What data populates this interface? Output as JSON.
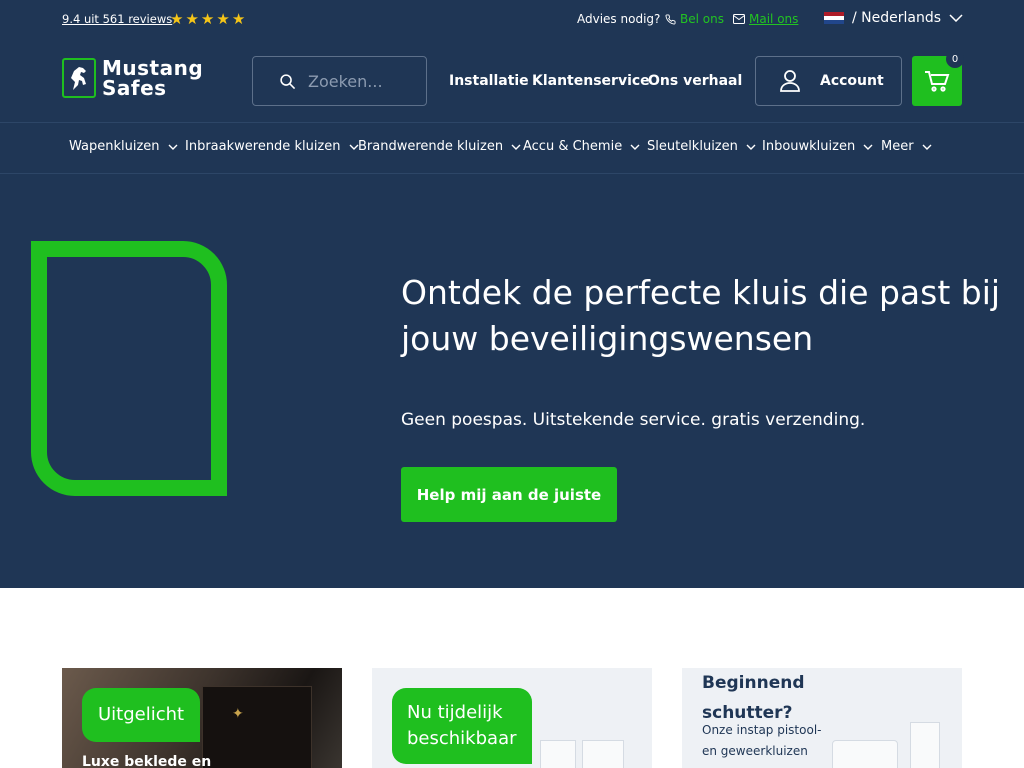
{
  "topbar": {
    "reviews": "9.4 uit 561 reviews",
    "star_count": 5,
    "advies": "Advies nodig?",
    "bel": "Bel ons",
    "mail": "Mail ons",
    "language": "/ Nederlands"
  },
  "logo": {
    "line1": "Mustang",
    "line2": "Safes"
  },
  "search": {
    "placeholder": "Zoeken..."
  },
  "main_nav": [
    "Installatie",
    "Klantenservice",
    "Ons verhaal"
  ],
  "account": {
    "label": "Account"
  },
  "cart": {
    "count": "0"
  },
  "categories": [
    "Wapenkluizen",
    "Inbraakwerende kluizen",
    "Brandwerende kluizen",
    "Accu & Chemie",
    "Sleutelkluizen",
    "Inbouwkluizen",
    "Meer"
  ],
  "hero": {
    "title": "Ontdek de perfecte kluis die past bij jouw beveiligingswensen",
    "subtitle": "Geen poespas. Uitstekende service. gratis verzending.",
    "button": "Help mij aan de juiste"
  },
  "cards": [
    {
      "badge": "Uitgelicht",
      "text": "Luxe beklede en"
    },
    {
      "badge": "Nu tijdelijk beschikbaar"
    },
    {
      "title": "Beginnend schutter?",
      "text": "Onze instap pistool- en geweerkluizen"
    }
  ],
  "colors": {
    "navy": "#1f3655",
    "green": "#1fbf1f",
    "star": "#f5c518"
  }
}
